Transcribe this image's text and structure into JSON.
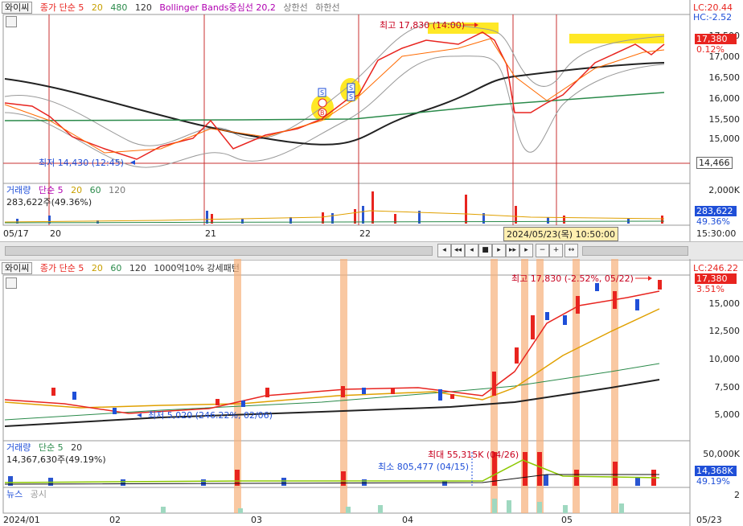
{
  "top": {
    "legend": {
      "name": "와이씨",
      "ma_label": "종가 단순 5",
      "ma2": "20",
      "ma3": "480",
      "ma4": "120",
      "bb_label": "Bollinger Bands중심선 20,2",
      "upper": "상한선",
      "lower": "하한선"
    },
    "lc": "LC:20.44",
    "hc": "HC:-2.52",
    "yticks": [
      "17,500",
      "17,000",
      "16,500",
      "16,000",
      "15,500",
      "15,000"
    ],
    "price_box": "17,380",
    "pct_box": "0.12%",
    "ref_box": "14,466",
    "high_label": "최고 17,830 (14:00)",
    "low_label": "최저 14,430 (12:45)",
    "volume": {
      "title": "거래량",
      "ma_label": "단순 5",
      "ma2": "20",
      "ma3": "60",
      "ma4": "120",
      "value": "283,622주(49.36%)",
      "yticks": [
        "2,000K"
      ],
      "box1": "283,622",
      "box2": "49.36%"
    },
    "xlabels": [
      "05/17",
      "20",
      "21",
      "22"
    ],
    "time_box": "2024/05/23(목) 10:50:00",
    "time_right": "15:30:00"
  },
  "bottom": {
    "legend": {
      "name": "와이씨",
      "ma_label": "종가 단순 5",
      "ma2": "20",
      "ma3": "60",
      "ma4": "120",
      "pattern": "1000억10% 강세패턴"
    },
    "lc": "LC:246.22",
    "yticks": [
      "15,000",
      "12,500",
      "10,000",
      "7,500",
      "5,000"
    ],
    "price_box": "17,380",
    "pct_box": "3.51%",
    "high_label": "최고 17,830 (-2.52%, 05/22)",
    "low_label": "최저 5,020 (246.22%, 02/06)",
    "volume": {
      "title": "거래량",
      "ma_label": "단순 5",
      "ma2": "20",
      "value": "14,367,630주(49.19%)",
      "max_label": "최대 55,315K (04/26)",
      "min_label": "최소 805,477 (04/15)",
      "ytick": "50,000K",
      "box1": "14,368K",
      "box2": "49.19%"
    },
    "news": {
      "label1": "뉴스",
      "label2": "공시",
      "ytick": "2"
    },
    "xlabels": [
      "2024/01",
      "02",
      "03",
      "04",
      "05"
    ],
    "xright": "05/23"
  },
  "colors": {
    "up": "#e8241f",
    "down": "#1f4fd8",
    "accent": "#c8001e"
  }
}
